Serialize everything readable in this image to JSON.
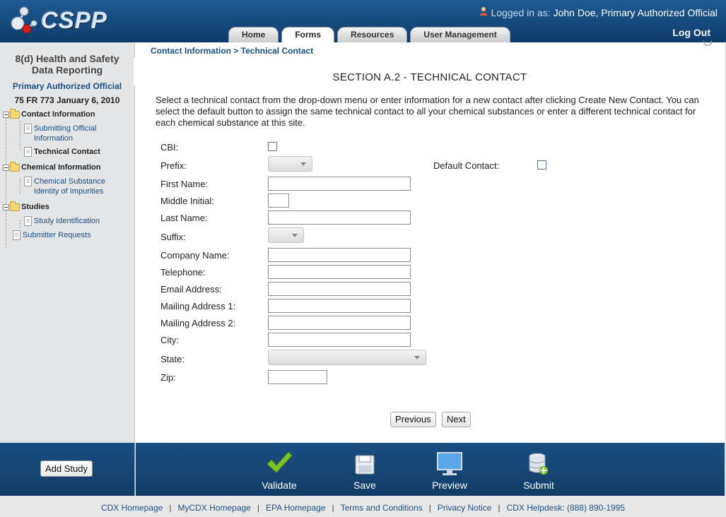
{
  "header": {
    "logo_text": "CSPP",
    "user_prefix": "Logged in as:",
    "user_name": "John Doe, Primary Authorized Official",
    "logout": "Log Out",
    "tabs": [
      {
        "label": "Home"
      },
      {
        "label": "Forms"
      },
      {
        "label": "Resources"
      },
      {
        "label": "User Management"
      }
    ],
    "active_tab": "Forms"
  },
  "sidebar": {
    "title_line1": "8(d) Health and Safety",
    "title_line2": "Data Reporting",
    "role": "Primary Authorized Official",
    "reference": "75 FR 773 January 6, 2010",
    "groups": [
      {
        "label": "Contact Information",
        "items": [
          {
            "label_line1": "Submitting Official",
            "label_line2": "Information"
          },
          {
            "label_line1": "Technical Contact",
            "label_line2": ""
          }
        ]
      },
      {
        "label": "Chemical Information",
        "items": [
          {
            "label_line1": "Chemical Substance",
            "label_line2": "Identity of Impurities"
          }
        ]
      },
      {
        "label": "Studies",
        "items": [
          {
            "label_line1": "Study Identification",
            "label_line2": ""
          }
        ]
      }
    ],
    "root_item": "Submitter Requests",
    "current_item": "Technical Contact"
  },
  "main": {
    "breadcrumb": "Contact Information > Technical Contact",
    "section_title": "SECTION A.2 - TECHNICAL CONTACT",
    "intro": "Select a technical contact from the drop-down menu or enter information for a new contact after clicking Create New Contact. You can select the default button to assign the same technical contact to all your chemical substances or enter a different technical contact for each chemical substance at this site.",
    "form": {
      "cbi_label": "CBI:",
      "cbi_checked": false,
      "prefix_label": "Prefix:",
      "prefix_value": "",
      "default_contact_label": "Default Contact:",
      "default_contact_checked": false,
      "first_name_label": "First Name:",
      "first_name_value": "",
      "middle_initial_label": "Middle Initial:",
      "middle_initial_value": "",
      "last_name_label": "Last Name:",
      "last_name_value": "",
      "suffix_label": "Suffix:",
      "suffix_value": "",
      "company_name_label": "Company Name:",
      "company_name_value": "",
      "telephone_label": "Telephone:",
      "telephone_value": "",
      "email_label": "Email Address:",
      "email_value": "",
      "mailing1_label": "Mailing Address 1:",
      "mailing1_value": "",
      "mailing2_label": "Mailing Address 2:",
      "mailing2_value": "",
      "city_label": "City:",
      "city_value": "",
      "state_label": "State:",
      "state_value": "",
      "zip_label": "Zip:",
      "zip_value": ""
    },
    "buttons": {
      "previous": "Previous",
      "next": "Next"
    }
  },
  "bottom_bar": {
    "add_study": "Add Study",
    "actions": [
      {
        "label": "Validate",
        "icon": "checkmark-icon"
      },
      {
        "label": "Save",
        "icon": "floppy-disk-icon"
      },
      {
        "label": "Preview",
        "icon": "monitor-icon"
      },
      {
        "label": "Submit",
        "icon": "database-add-icon"
      }
    ]
  },
  "footer": {
    "links": [
      "CDX Homepage",
      "MyCDX Homepage",
      "EPA Homepage",
      "Terms and Conditions",
      "Privacy Notice",
      "CDX Helpdesk: (888) 890-1995"
    ]
  },
  "colors": {
    "header_blue": "#1f5b92",
    "link_blue": "#1b4f82",
    "checkmark_green": "#7cc12a"
  }
}
